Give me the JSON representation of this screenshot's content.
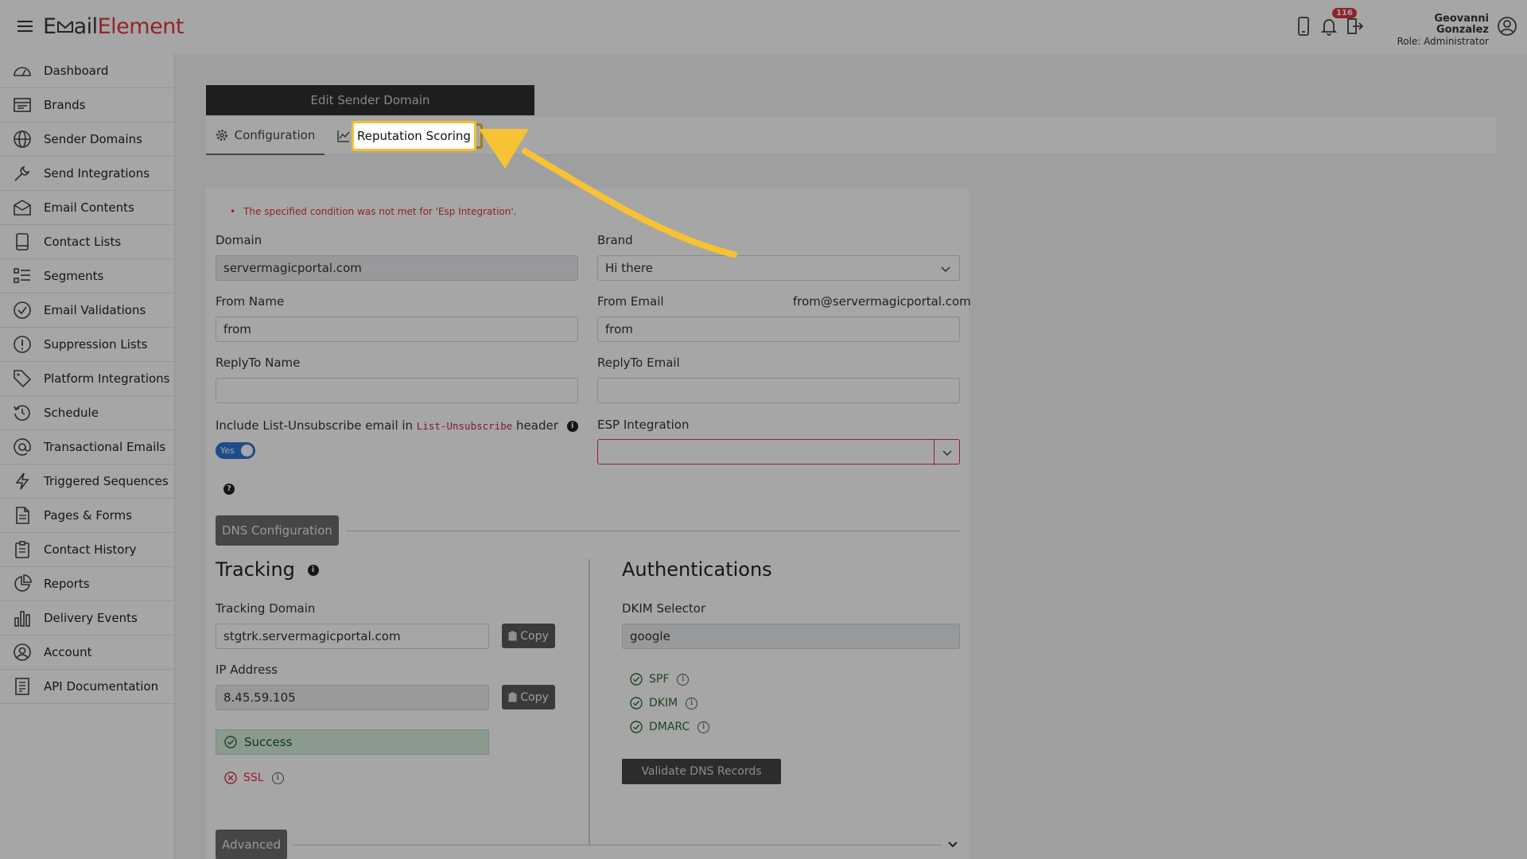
{
  "app": {
    "logo_part1": "E",
    "logo_part2": "ail",
    "logo_part3": "Element"
  },
  "header": {
    "notification_count": "116",
    "user_name": "Geovanni Gonzalez",
    "user_role": "Role: Administrator"
  },
  "sidebar": {
    "items": [
      {
        "label": "Dashboard",
        "icon": "dashboard-icon"
      },
      {
        "label": "Brands",
        "icon": "brands-icon"
      },
      {
        "label": "Sender Domains",
        "icon": "globe-icon"
      },
      {
        "label": "Send Integrations",
        "icon": "wrench-icon"
      },
      {
        "label": "Email Contents",
        "icon": "envelope-icon"
      },
      {
        "label": "Contact Lists",
        "icon": "book-icon"
      },
      {
        "label": "Segments",
        "icon": "segments-icon"
      },
      {
        "label": "Email Validations",
        "icon": "check-circle-icon"
      },
      {
        "label": "Suppression Lists",
        "icon": "exclamation-circle-icon"
      },
      {
        "label": "Platform Integrations",
        "icon": "tag-icon"
      },
      {
        "label": "Schedule",
        "icon": "clock-icon"
      },
      {
        "label": "Transactional Emails",
        "icon": "at-icon"
      },
      {
        "label": "Triggered Sequences",
        "icon": "lightning-icon"
      },
      {
        "label": "Pages & Forms",
        "icon": "file-icon"
      },
      {
        "label": "Contact History",
        "icon": "clipboard-icon"
      },
      {
        "label": "Reports",
        "icon": "pie-chart-icon"
      },
      {
        "label": "Delivery Events",
        "icon": "bar-chart-icon"
      },
      {
        "label": "Account",
        "icon": "user-circle-icon"
      },
      {
        "label": "API Documentation",
        "icon": "document-icon"
      }
    ]
  },
  "page": {
    "card_title": "Edit Sender Domain",
    "tabs": {
      "configuration": "Configuration",
      "reputation": "Reputation Scoring"
    },
    "error_message": "The specified condition was not met for 'Esp Integration'."
  },
  "form": {
    "domain_label": "Domain",
    "domain_value": "servermagicportal.com",
    "brand_label": "Brand",
    "brand_value": "Hi there",
    "from_name_label": "From Name",
    "from_name_value": "from",
    "from_email_label": "From Email",
    "from_email_hint": "from@servermagicportal.com",
    "from_email_value": "from",
    "replyto_name_label": "ReplyTo Name",
    "replyto_name_value": "",
    "replyto_email_label": "ReplyTo Email",
    "replyto_email_value": "",
    "unsub_prefix": "Include List-Unsubscribe email in",
    "unsub_code": "List-Unsubscribe",
    "unsub_suffix": "header",
    "toggle_label": "Yes",
    "esp_label": "ESP Integration",
    "esp_value": ""
  },
  "dns": {
    "section_label": "DNS Configuration",
    "tracking_title": "Tracking",
    "tracking_domain_label": "Tracking Domain",
    "tracking_domain_value": "stgtrk.servermagicportal.com",
    "ip_label": "IP Address",
    "ip_value": "8.45.59.105",
    "copy_label": "Copy",
    "success_label": "Success",
    "ssl_label": "SSL",
    "auth_title": "Authentications",
    "dkim_selector_label": "DKIM Selector",
    "dkim_selector_value": "google",
    "spf_label": "SPF",
    "dkim_label": "DKIM",
    "dmarc_label": "DMARC",
    "validate_label": "Validate DNS Records"
  },
  "advanced": {
    "section_label": "Advanced"
  },
  "colors": {
    "accent": "#2f75d6",
    "error": "#dc3545",
    "highlight": "#f2c12e",
    "brand_red": "#e03a3e"
  }
}
